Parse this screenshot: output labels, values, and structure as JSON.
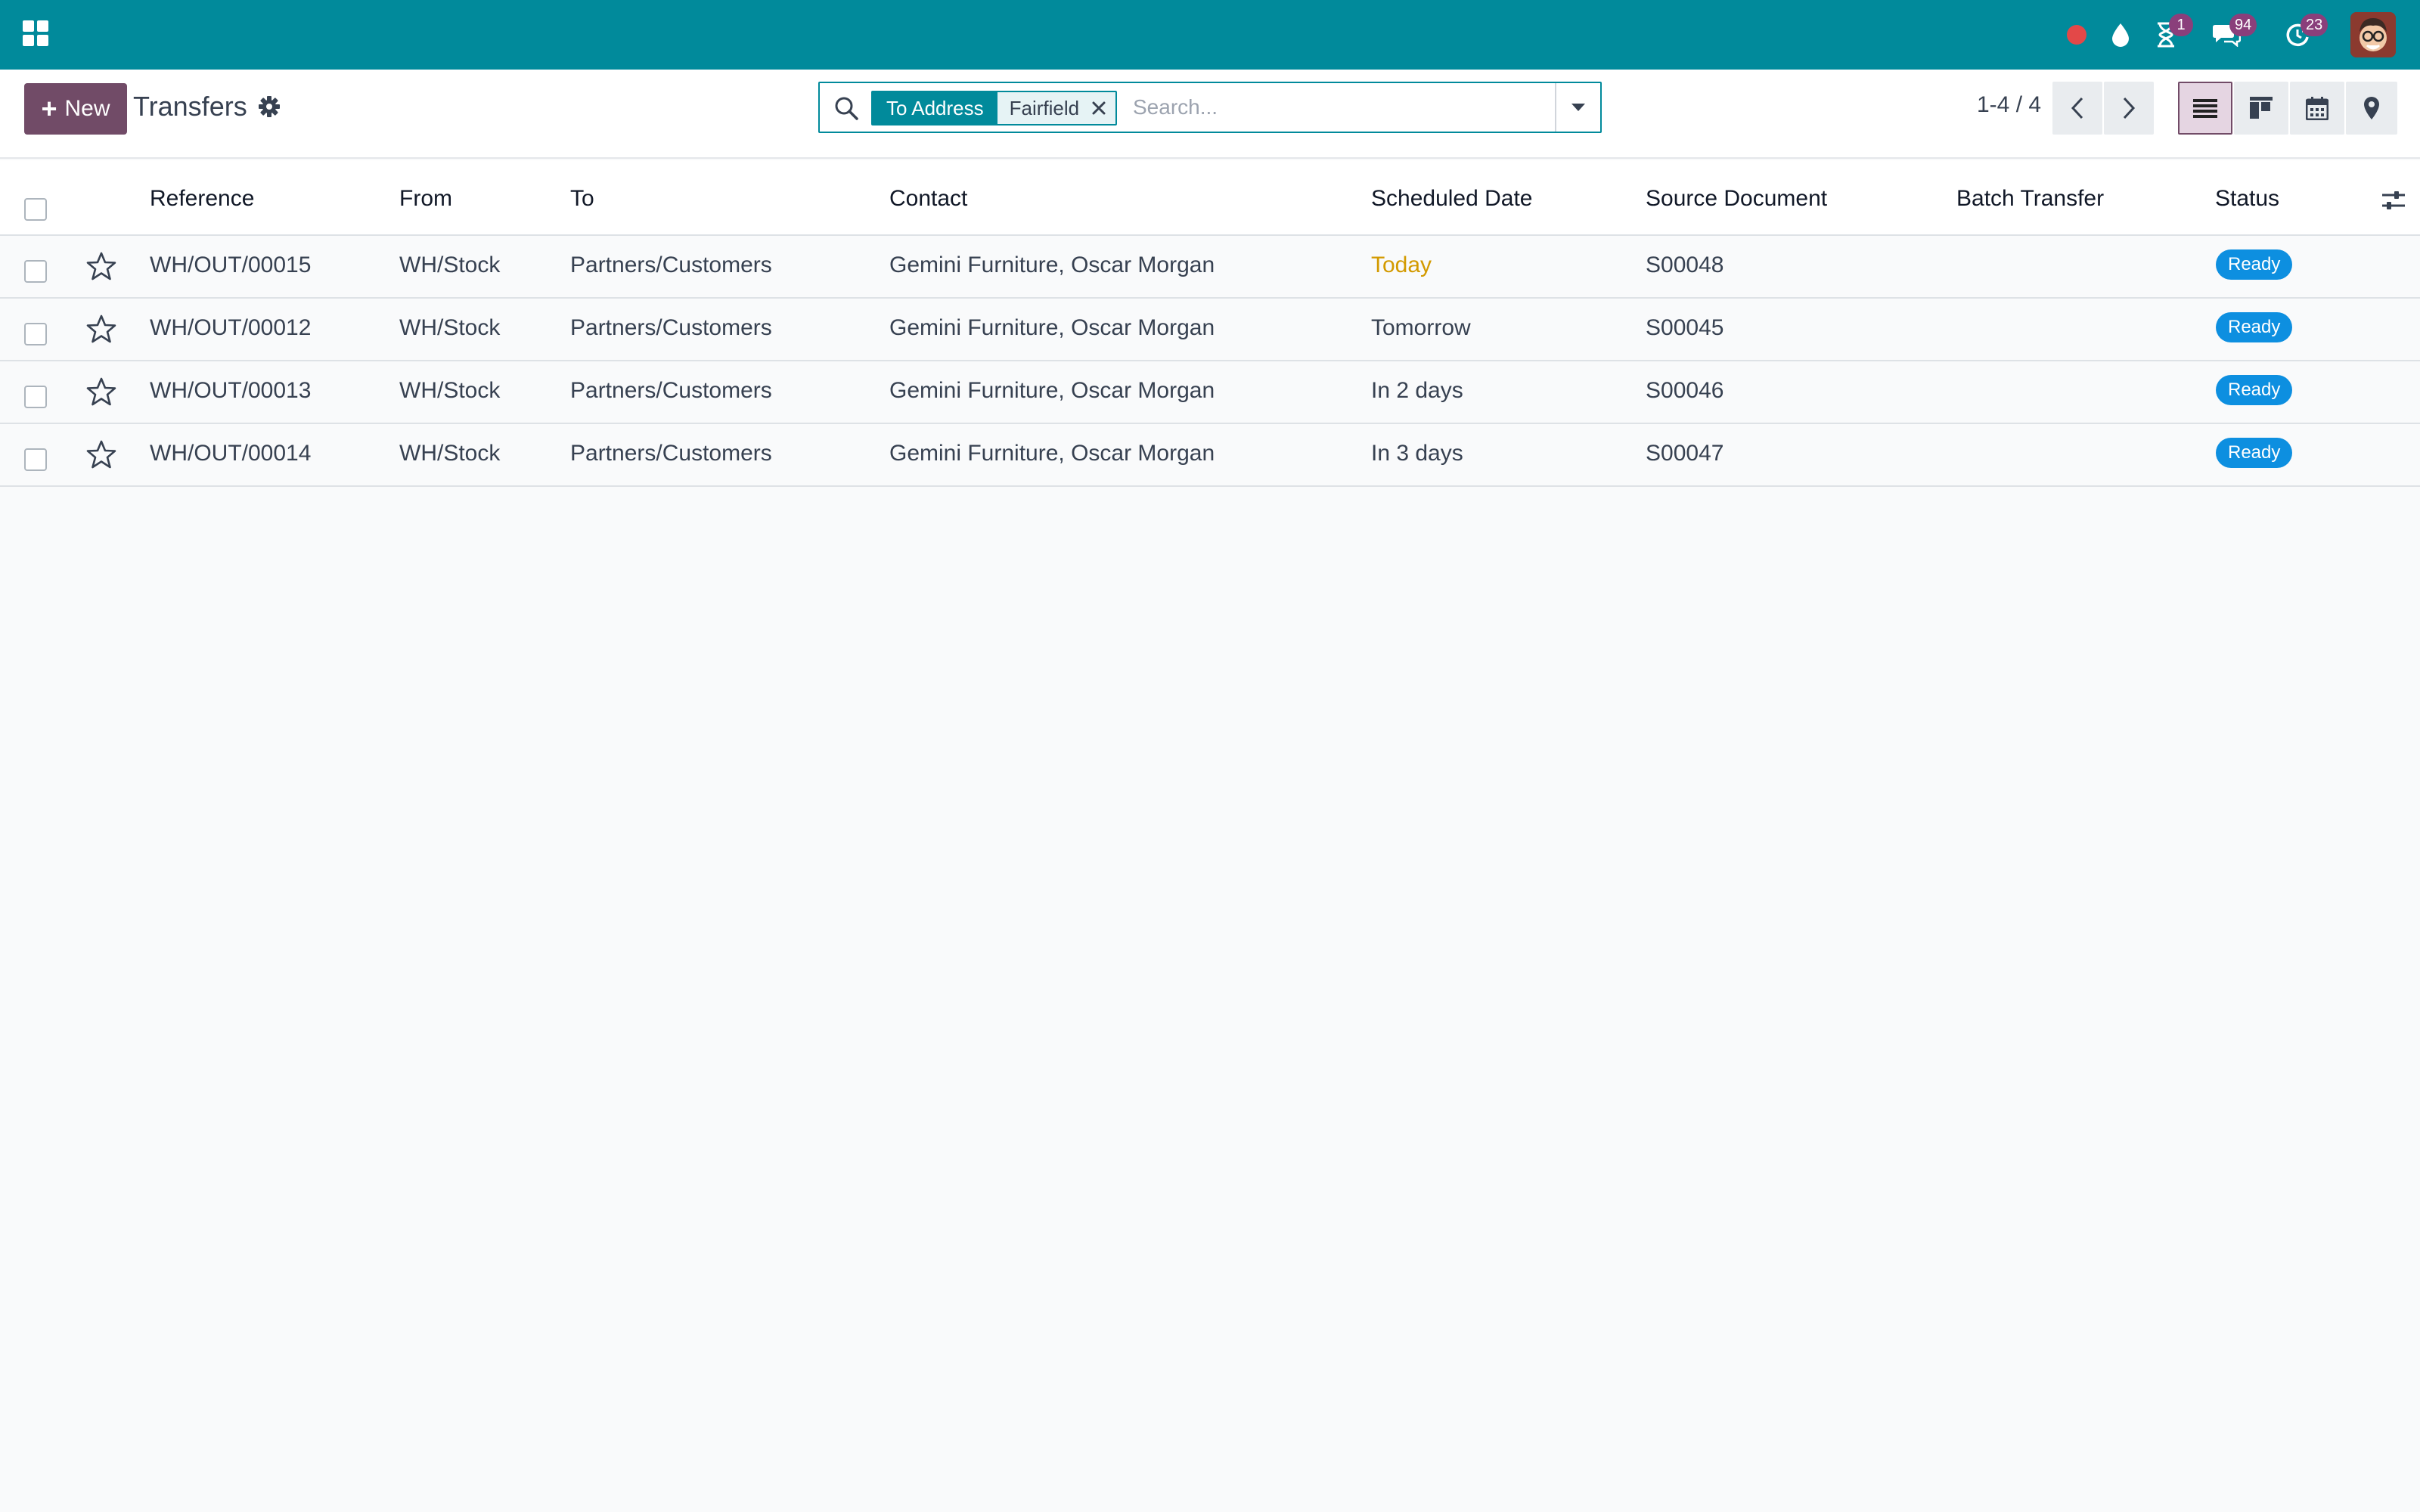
{
  "navbar": {
    "badges": {
      "activity": "1",
      "messages": "94",
      "updates": "23"
    }
  },
  "control": {
    "new_label": "New",
    "title": "Transfers",
    "search": {
      "facet_label": "To Address",
      "facet_value": "Fairfield",
      "placeholder": "Search..."
    },
    "pager": "1-4 / 4"
  },
  "table": {
    "columns": [
      "Reference",
      "From",
      "To",
      "Contact",
      "Scheduled Date",
      "Source Document",
      "Batch Transfer",
      "Status"
    ],
    "rows": [
      {
        "reference": "WH/OUT/00015",
        "from": "WH/Stock",
        "to": "Partners/Customers",
        "contact": "Gemini Furniture, Oscar Morgan",
        "scheduled": "Today",
        "source": "S00048",
        "batch": "",
        "status": "Ready"
      },
      {
        "reference": "WH/OUT/00012",
        "from": "WH/Stock",
        "to": "Partners/Customers",
        "contact": "Gemini Furniture, Oscar Morgan",
        "scheduled": "Tomorrow",
        "source": "S00045",
        "batch": "",
        "status": "Ready"
      },
      {
        "reference": "WH/OUT/00013",
        "from": "WH/Stock",
        "to": "Partners/Customers",
        "contact": "Gemini Furniture, Oscar Morgan",
        "scheduled": "In 2 days",
        "source": "S00046",
        "batch": "",
        "status": "Ready"
      },
      {
        "reference": "WH/OUT/00014",
        "from": "WH/Stock",
        "to": "Partners/Customers",
        "contact": "Gemini Furniture, Oscar Morgan",
        "scheduled": "In 3 days",
        "source": "S00047",
        "batch": "",
        "status": "Ready"
      }
    ]
  },
  "colors": {
    "navbar": "#018a9b",
    "primary": "#714b67",
    "badge": "#8a3f7b",
    "status_ready": "#0d8fe0",
    "today": "#d39a00"
  },
  "icons": [
    "apps-grid-icon",
    "record-dot-icon",
    "droplet-icon",
    "hourglass-icon",
    "chat-icon",
    "refresh-clock-icon",
    "gear-icon",
    "search-icon",
    "close-icon",
    "caret-down-icon",
    "chevron-left-icon",
    "chevron-right-icon",
    "list-view-icon",
    "kanban-view-icon",
    "calendar-view-icon",
    "map-pin-icon",
    "star-icon",
    "column-settings-icon"
  ]
}
